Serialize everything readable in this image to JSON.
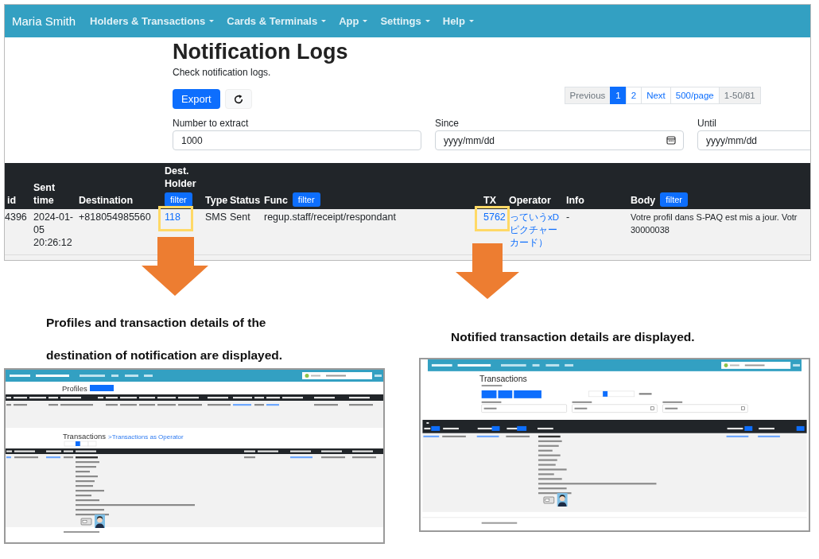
{
  "main_screen": {
    "navbar": {
      "brand": "Maria Smith",
      "menus": [
        {
          "label": "Holders & Transactions"
        },
        {
          "label": "Cards & Terminals"
        },
        {
          "label": "App"
        },
        {
          "label": "Settings"
        },
        {
          "label": "Help"
        }
      ]
    },
    "title": "Notification Logs",
    "subtitle": "Check notification logs.",
    "export_button": "Export",
    "pagination": [
      {
        "label": "Previous",
        "selected": false,
        "disabled": true
      },
      {
        "label": "1",
        "selected": true,
        "disabled": false
      },
      {
        "label": "2",
        "selected": false,
        "disabled": false
      },
      {
        "label": "Next",
        "selected": false,
        "disabled": false
      },
      {
        "label": "500/page",
        "selected": false,
        "disabled": false
      },
      {
        "label": "1-50/81",
        "selected": false,
        "disabled": true
      }
    ],
    "fields": [
      {
        "kind": "text",
        "label": "Number to extract",
        "value": "1000"
      },
      {
        "kind": "date",
        "label": "Since",
        "placeholder": "yyyy/mm/dd"
      },
      {
        "kind": "date",
        "label": "Until",
        "placeholder": "yyyy/mm/dd"
      }
    ],
    "table": {
      "columns": [
        {
          "label": "id"
        },
        {
          "label": "Sent time"
        },
        {
          "label": "Destination"
        },
        {
          "label": "Dest. Holder",
          "filter_button": "filter"
        },
        {
          "label": "Type"
        },
        {
          "label": "Status"
        },
        {
          "label": "Func",
          "filter_button": "filter"
        },
        {
          "label": "TX"
        },
        {
          "label": "Operator"
        },
        {
          "label": "Info"
        },
        {
          "label": "Body",
          "filter_button": "filter"
        }
      ],
      "rows": [
        {
          "cells": [
            {
              "kind": "text",
              "text": "4396",
              "highlighted": false
            },
            {
              "kind": "text",
              "text": "2024-01-05 20:26:12",
              "highlighted": false
            },
            {
              "kind": "text",
              "text": "+818054985560",
              "highlighted": false
            },
            {
              "kind": "link",
              "text": "118",
              "highlighted": true
            },
            {
              "kind": "text",
              "text": "SMS",
              "highlighted": false
            },
            {
              "kind": "text",
              "text": "Sent",
              "highlighted": false
            },
            {
              "kind": "text",
              "text": "regup.staff/receipt/respondant",
              "highlighted": false
            },
            {
              "kind": "link",
              "text": "5762",
              "highlighted": true
            },
            {
              "kind": "link",
              "text": "っていうxDピクチャーカード）",
              "highlighted": false
            },
            {
              "kind": "text",
              "text": "-",
              "highlighted": false
            },
            {
              "kind": "text",
              "text": "Votre profil dans S-PAQ est mis a jour. Votr\n30000038",
              "highlighted": false
            }
          ]
        }
      ]
    }
  },
  "captions": [
    "Profiles and transaction details of the destination of notification are displayed.",
    "Notified transaction details are displayed."
  ],
  "left_screen": {
    "profiles_title": "Profiles",
    "transactions_title": "Transactions",
    "transactions_link": ">Transactions as Operator"
  },
  "right_screen": {
    "title": "Transactions"
  }
}
